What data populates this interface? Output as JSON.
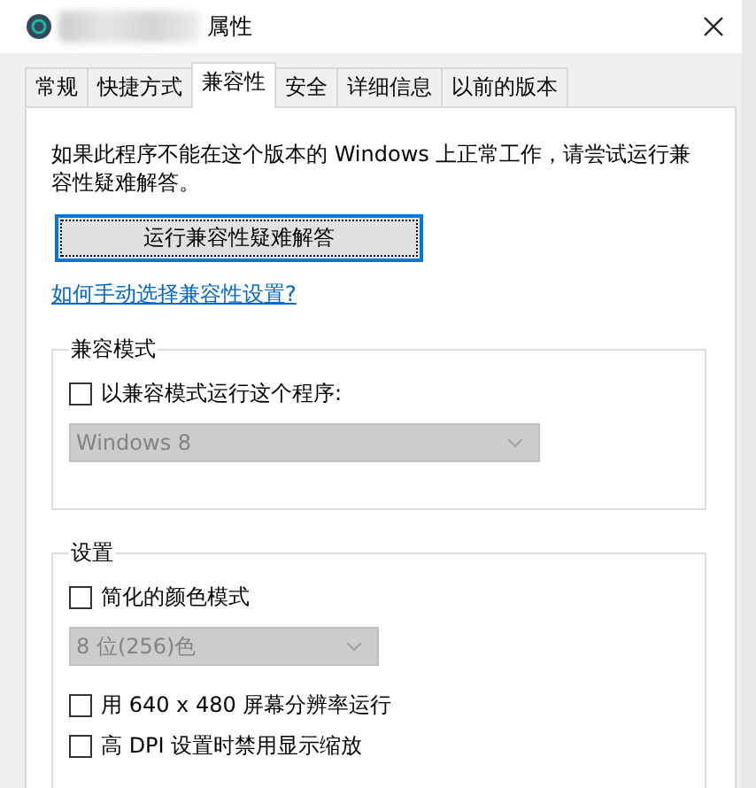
{
  "window": {
    "title": "属性"
  },
  "tabs": [
    {
      "label": "常规",
      "selected": false
    },
    {
      "label": "快捷方式",
      "selected": false
    },
    {
      "label": "兼容性",
      "selected": true
    },
    {
      "label": "安全",
      "selected": false
    },
    {
      "label": "详细信息",
      "selected": false
    },
    {
      "label": "以前的版本",
      "selected": false
    }
  ],
  "description": "如果此程序不能在这个版本的 Windows 上正常工作，请尝试运行兼容性疑难解答。",
  "troubleshoot_button": "运行兼容性疑难解答",
  "help_link": "如何手动选择兼容性设置?",
  "groups": [
    {
      "title": "兼容模式",
      "items": [
        {
          "kind": "checkbox",
          "label": "以兼容模式运行这个程序:",
          "checked": false
        },
        {
          "kind": "dropdown",
          "value": "Windows 8",
          "disabled": true
        }
      ]
    },
    {
      "title": "设置",
      "items": [
        {
          "kind": "checkbox",
          "label": "简化的颜色模式",
          "checked": false
        },
        {
          "kind": "dropdown",
          "value": "8 位(256)色",
          "disabled": true
        },
        {
          "kind": "checkbox",
          "label": "用 640 x 480 屏幕分辨率运行",
          "checked": false
        },
        {
          "kind": "checkbox",
          "label": "高 DPI 设置时禁用显示缩放",
          "checked": false
        }
      ]
    }
  ]
}
